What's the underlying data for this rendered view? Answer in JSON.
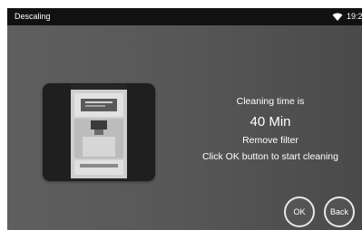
{
  "status_bar": {
    "title": "Descaling",
    "time": "19:2",
    "wifi_icon": "wifi-icon"
  },
  "machine_image": {
    "icon": "coffee-machine-illustration"
  },
  "info": {
    "cleaning_label": "Cleaning time is",
    "duration": "40 Min",
    "remove_filter": "Remove filter",
    "instruction": "Click OK button to start cleaning"
  },
  "buttons": {
    "ok_label": "OK",
    "back_label": "Back"
  },
  "colors": {
    "status_bar_bg": "#111111",
    "screen_bg": "#585858",
    "text": "#ffffff",
    "button_border": "#e8e8e8"
  }
}
